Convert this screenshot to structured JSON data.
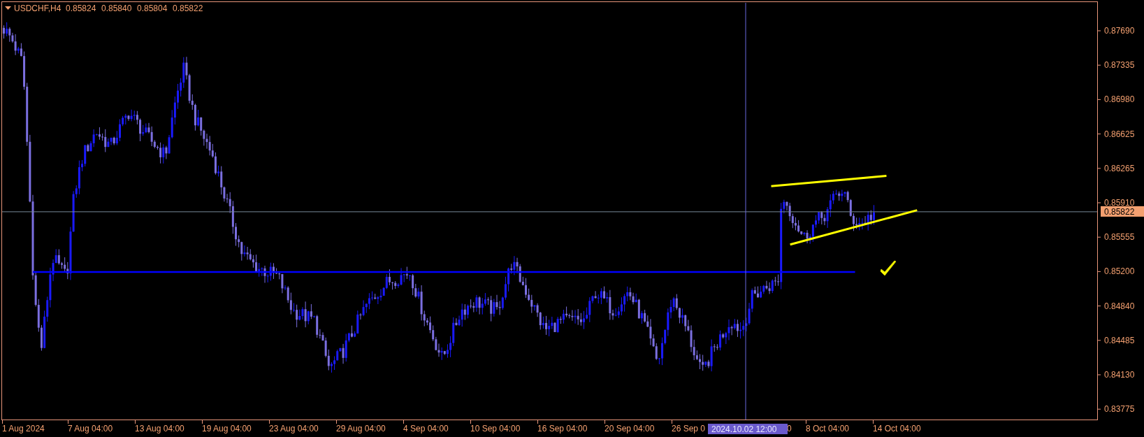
{
  "chart_header": {
    "symbol": "USDCHF,H4",
    "ohlc": [
      "0.85824",
      "0.85840",
      "0.85804",
      "0.85822"
    ]
  },
  "price_axis": [
    "0.87690",
    "0.87335",
    "0.86980",
    "0.86625",
    "0.86265",
    "0.85910",
    "0.85555",
    "0.85200",
    "0.84840",
    "0.84485",
    "0.84130",
    "0.83775"
  ],
  "current_price": "0.85822",
  "time_axis": [
    "1 Aug 2024",
    "7 Aug 04:00",
    "13 Aug 04:00",
    "19 Aug 04:00",
    "23 Aug 04:00",
    "29 Aug 04:00",
    "4 Sep 04:00",
    "10 Sep 04:00",
    "16 Sep 04:00",
    "20 Sep 04:00",
    "26 Sep 0",
    "0",
    "8 Oct 04:00",
    "14 Oct 04:00"
  ],
  "crosshair_time": "2024.10.02 12:00"
}
